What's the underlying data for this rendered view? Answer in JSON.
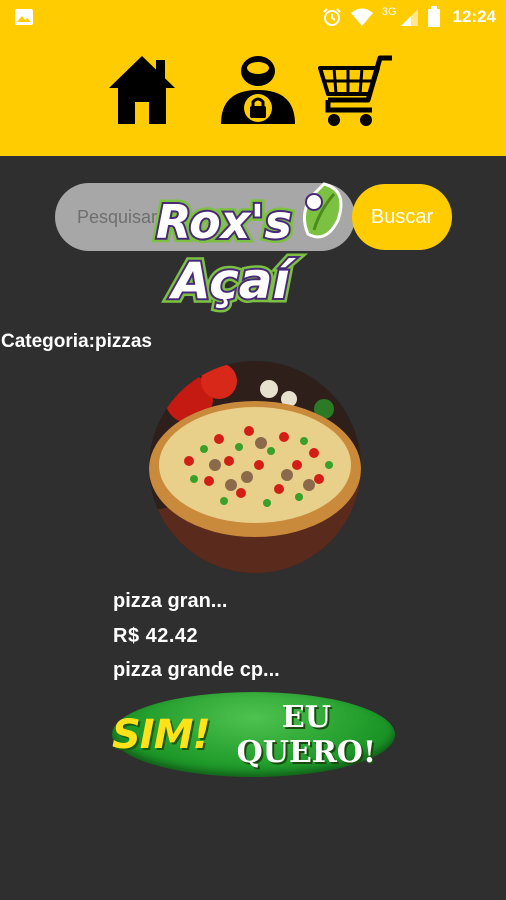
{
  "status_bar": {
    "network": "3G",
    "time": "12:24",
    "icons": [
      "gallery-icon",
      "alarm-icon",
      "wifi-icon",
      "signal-icon",
      "battery-icon"
    ]
  },
  "toolbar": {
    "icons": [
      "home-icon",
      "user-lock-icon",
      "cart-icon"
    ]
  },
  "search": {
    "placeholder": "Pesquisar...",
    "button_label": "Buscar"
  },
  "logo": {
    "line1": "Rox's",
    "line2": "Açaí"
  },
  "category": {
    "label": "Categoria:pizzas"
  },
  "product": {
    "name": "pizza gran...",
    "price": "R$ 42.42",
    "description": "pizza grande cp..."
  },
  "cta": {
    "sim": "SIM!",
    "quero": "EU QUERO!"
  },
  "colors": {
    "accent": "#fecc00",
    "background": "#2f2f2f",
    "cta_green": "#1f9a2a",
    "logo_purple": "#4a2a78",
    "logo_green": "#7cc142"
  }
}
